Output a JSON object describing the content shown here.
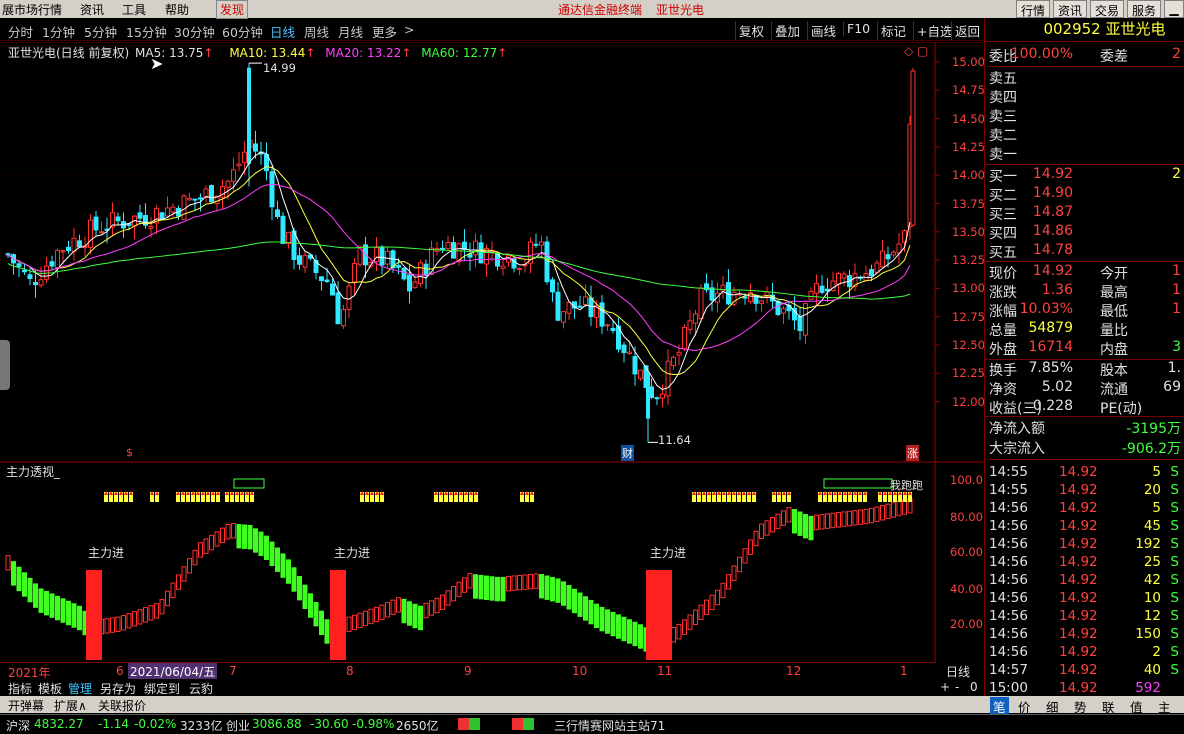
{
  "menubar": {
    "items": [
      "展市场行情",
      "资讯",
      "工具",
      "帮助"
    ],
    "discover": "发现",
    "center_title": "通达信金融终端",
    "center_stock": "亚世光电",
    "right_buttons": [
      "行情",
      "资讯",
      "交易",
      "服务"
    ]
  },
  "periods": [
    "分时",
    "1分钟",
    "5分钟",
    "15分钟",
    "30分钟",
    "60分钟",
    "日线",
    "周线",
    "月线",
    "更多",
    ">"
  ],
  "toolbar_right": [
    "复权",
    "叠加",
    "画线",
    "F10",
    "标记",
    "+自选",
    "返回"
  ],
  "chart_header": {
    "name": "亚世光电(日线 前复权)",
    "ma5": "MA5: 13.75",
    "ma10": "MA10: 13.44",
    "ma20": "MA20: 13.22",
    "ma60": "MA60: 12.77",
    "arrow": "↑",
    "high_label": "14.99",
    "low_label": "11.64",
    "marker_dollar": "$",
    "marker_cai": "财",
    "marker_zhang": "涨"
  },
  "price_axis": [
    "15.00",
    "14.75",
    "14.50",
    "14.25",
    "14.00",
    "13.75",
    "13.50",
    "13.25",
    "13.00",
    "12.75",
    "12.50",
    "12.25",
    "12.00"
  ],
  "indicator": {
    "title": "主力透视_",
    "axis": [
      "100.0",
      "80.00",
      "60.00",
      "40.00",
      "20.00"
    ],
    "labels": [
      "主力进",
      "主力进",
      "主力进"
    ],
    "overlay_text": "我跑跑"
  },
  "date_axis": {
    "year": "2021年",
    "selected": "2021/06/04/五",
    "months": [
      "6",
      "7",
      "8",
      "9",
      "10",
      "11",
      "12",
      "1"
    ],
    "period": "日线"
  },
  "bottom_tabs": [
    "指标",
    "模板",
    "管理",
    "另存为",
    "绑定到",
    "云豹"
  ],
  "bottom_tabs_active": "管理",
  "zoom_controls": [
    "+",
    "-",
    "0"
  ],
  "bottom_bar2": [
    "开弹幕",
    "扩展∧",
    "关联报价"
  ],
  "right_panel": {
    "code": "002952",
    "name": "亚世光电",
    "weibi_label": "委比",
    "weibi_value": "100.00%",
    "weicha_label": "委差",
    "weicha_value": "2",
    "sell_levels": [
      "卖五",
      "卖四",
      "卖三",
      "卖二",
      "卖一"
    ],
    "buy_levels": [
      {
        "label": "买一",
        "price": "14.92",
        "vol": "2"
      },
      {
        "label": "买二",
        "price": "14.90",
        "vol": ""
      },
      {
        "label": "买三",
        "price": "14.87",
        "vol": ""
      },
      {
        "label": "买四",
        "price": "14.86",
        "vol": ""
      },
      {
        "label": "买五",
        "price": "14.78",
        "vol": ""
      }
    ],
    "stats": [
      {
        "l1": "现价",
        "v1": "14.92",
        "c1": "red",
        "l2": "今开",
        "v2": "1",
        "c2": "red"
      },
      {
        "l1": "涨跌",
        "v1": "1.36",
        "c1": "red",
        "l2": "最高",
        "v2": "1",
        "c2": "red"
      },
      {
        "l1": "涨幅",
        "v1": "10.03%",
        "c1": "red",
        "l2": "最低",
        "v2": "1",
        "c2": "red"
      },
      {
        "l1": "总量",
        "v1": "54879",
        "c1": "yel",
        "l2": "量比",
        "v2": "",
        "c2": "wht"
      },
      {
        "l1": "外盘",
        "v1": "16714",
        "c1": "red",
        "l2": "内盘",
        "v2": "3",
        "c2": "grn"
      },
      {
        "l1": "换手",
        "v1": "7.85%",
        "c1": "wht",
        "l2": "股本",
        "v2": "1.",
        "c2": "wht"
      },
      {
        "l1": "净资",
        "v1": "5.02",
        "c1": "wht",
        "l2": "流通",
        "v2": "69",
        "c2": "wht"
      },
      {
        "l1": "收益(三)",
        "v1": "0.228",
        "c1": "wht",
        "l2": "PE(动)",
        "v2": "",
        "c2": "wht"
      }
    ],
    "net_inflow_label": "净流入额",
    "net_inflow_value": "-3195万",
    "block_inflow_label": "大宗流入",
    "block_inflow_value": "-906.2万",
    "ticks": [
      {
        "t": "14:55",
        "p": "14.92",
        "v": "5",
        "vc": "yel",
        "s": "S"
      },
      {
        "t": "14:55",
        "p": "14.92",
        "v": "20",
        "vc": "yel",
        "s": "S"
      },
      {
        "t": "14:56",
        "p": "14.92",
        "v": "5",
        "vc": "yel",
        "s": "S"
      },
      {
        "t": "14:56",
        "p": "14.92",
        "v": "45",
        "vc": "yel",
        "s": "S"
      },
      {
        "t": "14:56",
        "p": "14.92",
        "v": "192",
        "vc": "yel",
        "s": "S"
      },
      {
        "t": "14:56",
        "p": "14.92",
        "v": "25",
        "vc": "yel",
        "s": "S"
      },
      {
        "t": "14:56",
        "p": "14.92",
        "v": "42",
        "vc": "yel",
        "s": "S"
      },
      {
        "t": "14:56",
        "p": "14.92",
        "v": "10",
        "vc": "yel",
        "s": "S"
      },
      {
        "t": "14:56",
        "p": "14.92",
        "v": "12",
        "vc": "yel",
        "s": "S"
      },
      {
        "t": "14:56",
        "p": "14.92",
        "v": "150",
        "vc": "yel",
        "s": "S"
      },
      {
        "t": "14:56",
        "p": "14.92",
        "v": "2",
        "vc": "yel",
        "s": "S"
      },
      {
        "t": "14:57",
        "p": "14.92",
        "v": "40",
        "vc": "yel",
        "s": "S"
      },
      {
        "t": "15:00",
        "p": "14.92",
        "v": "592",
        "vc": "mag",
        "s": ""
      }
    ],
    "tabs": [
      "笔",
      "价",
      "细",
      "势",
      "联",
      "值",
      "主"
    ],
    "active_tab": "笔"
  },
  "statusbar": {
    "index1_name": "沪深",
    "index1_value": "4832.27",
    "index1_change": "-1.14",
    "index1_pct": "-0.02%",
    "index1_amount": "3233亿",
    "index2_name": "创业",
    "index2_value": "3086.88",
    "index2_change": "-30.60",
    "index2_pct": "-0.98%",
    "index2_amount": "2650亿",
    "news": "三行情赛网站主站71"
  },
  "colors": {
    "up": "#ff3030",
    "down": "#30e8ff",
    "ma5": "#ffffff",
    "ma10": "#ffff40",
    "ma20": "#ff40ff",
    "ma60": "#40ff40",
    "indicator_up": "#ff3030",
    "indicator_down": "#40ff20"
  }
}
